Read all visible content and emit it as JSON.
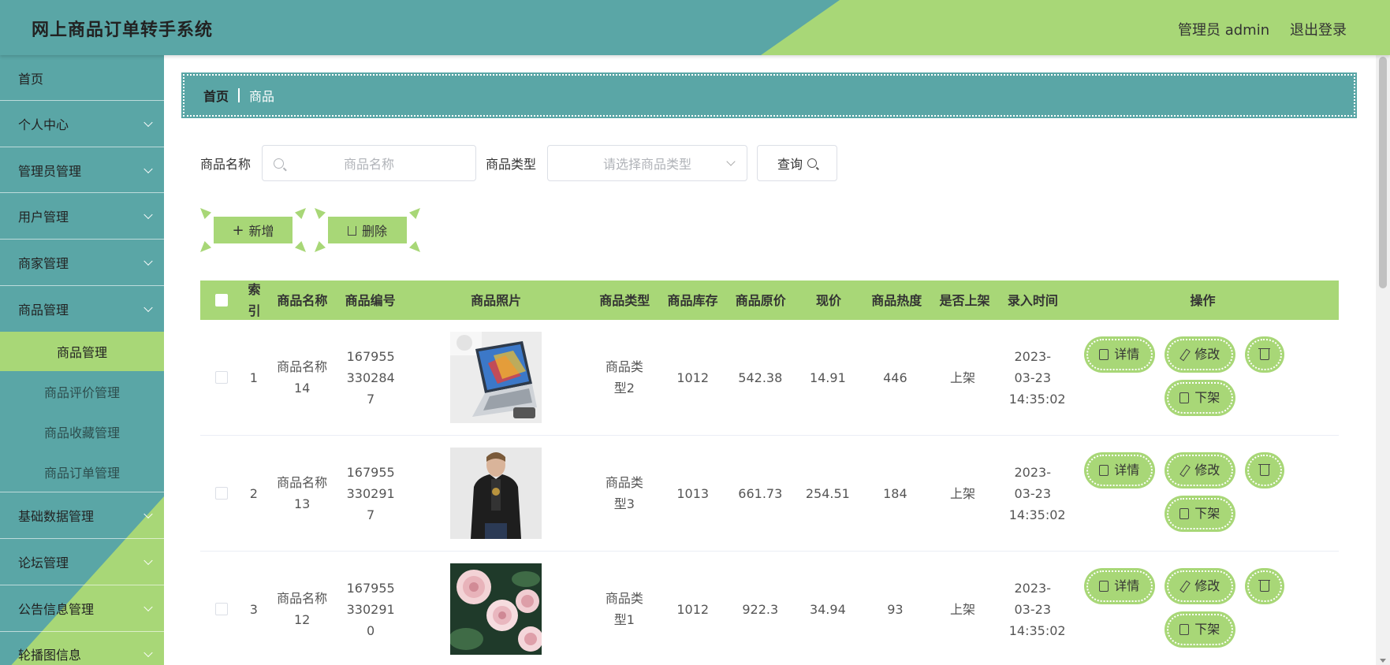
{
  "app": {
    "title": "网上商品订单转手系统",
    "user_label": "管理员 admin",
    "logout_label": "退出登录"
  },
  "colors": {
    "primary_teal": "#5aa6a6",
    "accent_green": "#a8d777"
  },
  "sidebar": {
    "items": [
      {
        "label": "首页",
        "expandable": false
      },
      {
        "label": "个人中心",
        "expandable": true
      },
      {
        "label": "管理员管理",
        "expandable": true
      },
      {
        "label": "用户管理",
        "expandable": true
      },
      {
        "label": "商家管理",
        "expandable": true
      },
      {
        "label": "商品管理",
        "expandable": true,
        "expanded": true
      }
    ],
    "submenu": [
      {
        "label": "商品管理",
        "active": true
      },
      {
        "label": "商品评价管理"
      },
      {
        "label": "商品收藏管理"
      },
      {
        "label": "商品订单管理"
      }
    ],
    "items_after": [
      {
        "label": "基础数据管理"
      },
      {
        "label": "论坛管理"
      },
      {
        "label": "公告信息管理"
      },
      {
        "label": "轮播图信息"
      }
    ]
  },
  "breadcrumb": {
    "home": "首页",
    "current": "商品"
  },
  "search": {
    "name_label": "商品名称",
    "name_placeholder": "商品名称",
    "type_label": "商品类型",
    "type_placeholder": "请选择商品类型",
    "query_label": "查询"
  },
  "actions": {
    "add_label": "新增",
    "delete_label": "删除"
  },
  "table": {
    "headers": [
      "索引",
      "商品名称",
      "商品编号",
      "商品照片",
      "商品类型",
      "商品库存",
      "商品原价",
      "现价",
      "商品热度",
      "是否上架",
      "录入时间",
      "操作"
    ],
    "op_labels": {
      "detail": "详情",
      "edit": "修改",
      "offshelf": "下架"
    },
    "rows": [
      {
        "index": "1",
        "name": "商品名称14",
        "code": "1679553302847",
        "photo": "laptop",
        "type": "商品类型2",
        "stock": "1012",
        "original_price": "542.38",
        "price": "14.91",
        "heat": "446",
        "on_shelf": "上架",
        "time": "2023-03-23 14:35:02"
      },
      {
        "index": "2",
        "name": "商品名称13",
        "code": "1679553302917",
        "photo": "jacket-man",
        "type": "商品类型3",
        "stock": "1013",
        "original_price": "661.73",
        "price": "254.51",
        "heat": "184",
        "on_shelf": "上架",
        "time": "2023-03-23 14:35:02"
      },
      {
        "index": "3",
        "name": "商品名称12",
        "code": "1679553302910",
        "photo": "roses",
        "type": "商品类型1",
        "stock": "1012",
        "original_price": "922.3",
        "price": "34.94",
        "heat": "93",
        "on_shelf": "上架",
        "time": "2023-03-23 14:35:02"
      }
    ]
  }
}
